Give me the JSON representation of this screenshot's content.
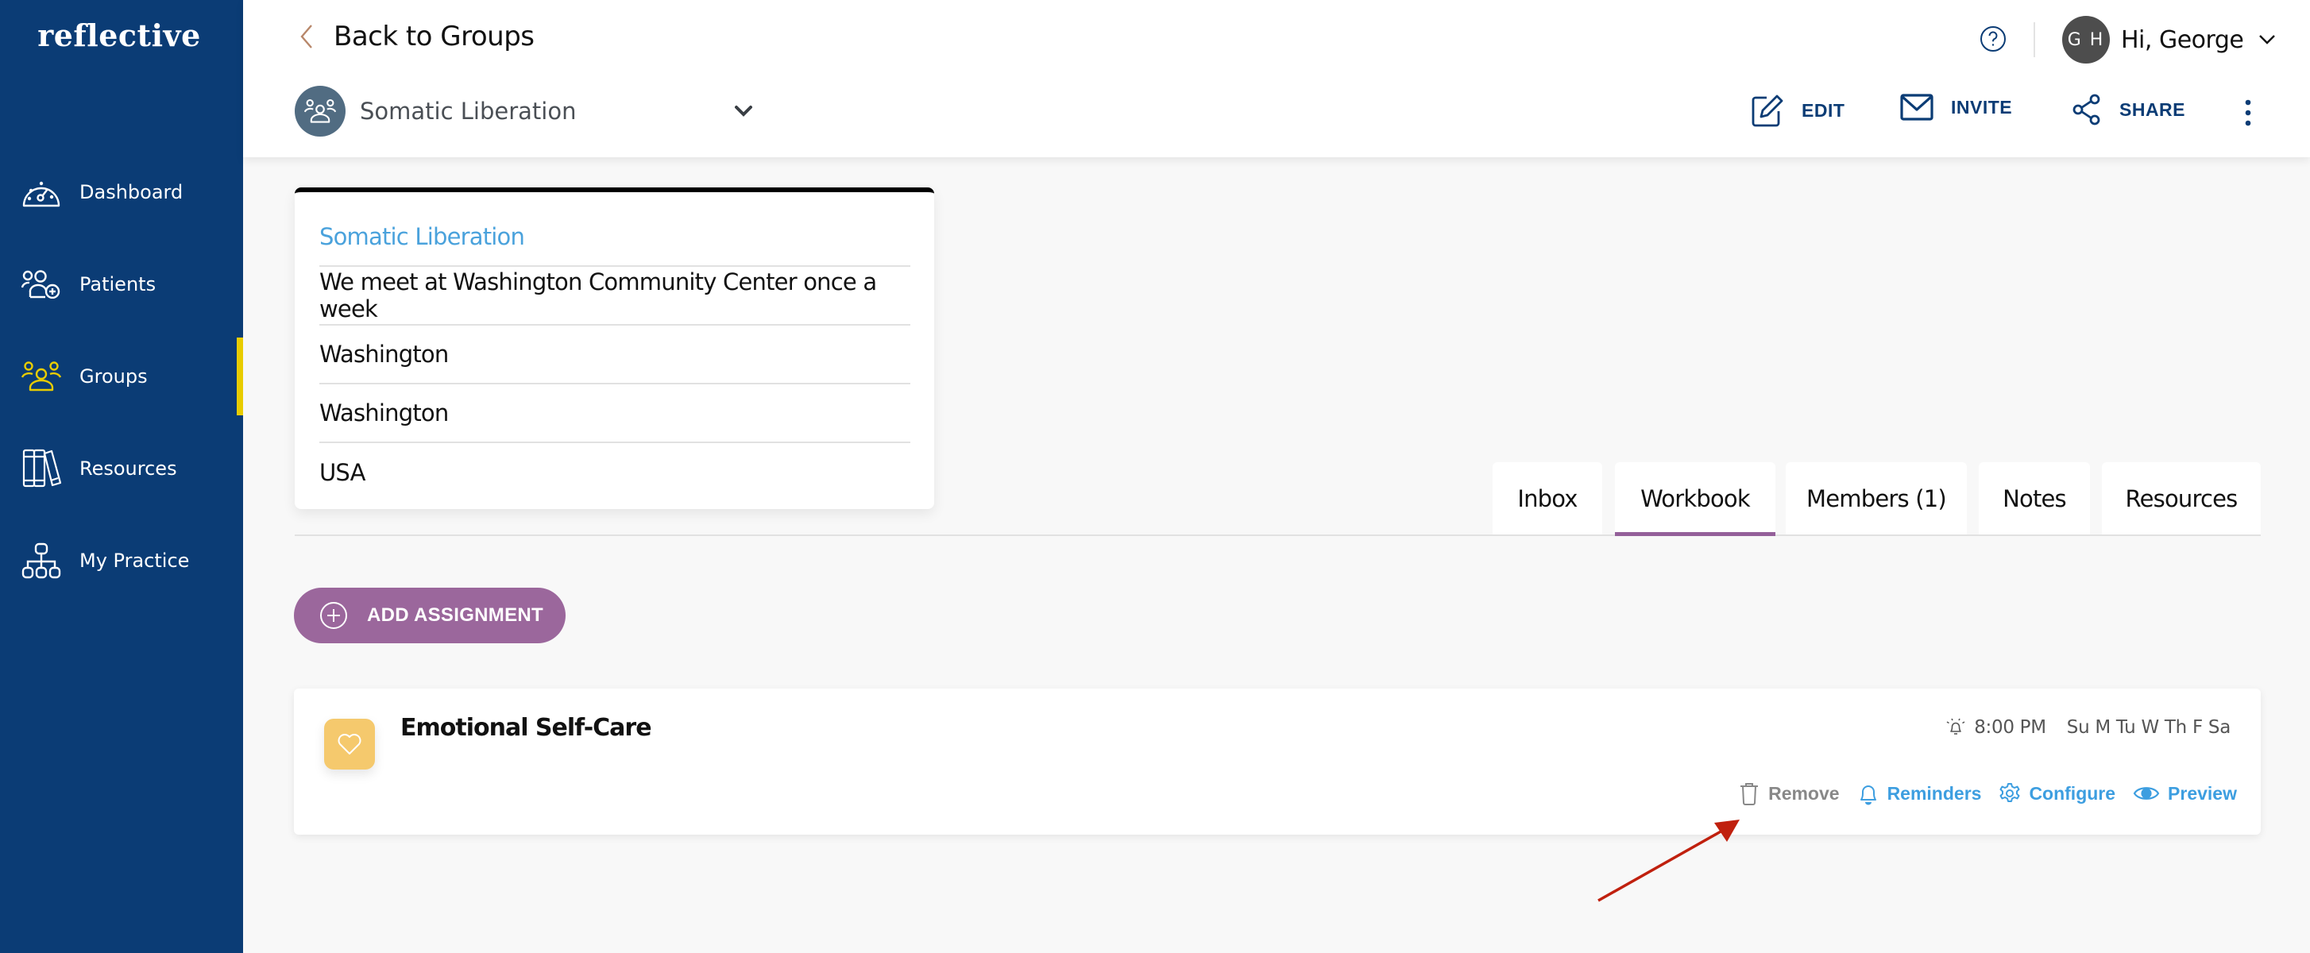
{
  "app": {
    "logo": "reflective",
    "brand_color": "#0b3c75",
    "active_indicator_color": "#e8cc00"
  },
  "sidebar": {
    "items": [
      {
        "label": "Dashboard",
        "icon": "gauge-icon",
        "active": false
      },
      {
        "label": "Patients",
        "icon": "add-users-icon",
        "active": false
      },
      {
        "label": "Groups",
        "icon": "group-icon",
        "active": true
      },
      {
        "label": "Resources",
        "icon": "books-icon",
        "active": false
      },
      {
        "label": "My Practice",
        "icon": "org-chart-icon",
        "active": false
      }
    ]
  },
  "header": {
    "back_label": "Back to Groups",
    "group_selector": {
      "selected": "Somatic Liberation"
    },
    "user": {
      "initials": "G H",
      "greeting": "Hi, George"
    },
    "actions": {
      "edit": "EDIT",
      "invite": "INVITE",
      "share": "SHARE"
    }
  },
  "info_card": {
    "title": "Somatic Liberation",
    "rows": [
      "We meet at Washington Community Center once a week",
      "Washington",
      "Washington",
      "USA"
    ]
  },
  "tabs": {
    "items": [
      "Inbox",
      "Workbook",
      "Members (1)",
      "Notes",
      "Resources"
    ],
    "active": "Workbook",
    "active_color": "#94609a"
  },
  "workbook": {
    "add_button_label": "ADD ASSIGNMENT",
    "add_button_color": "#9b679c",
    "assignments": [
      {
        "title": "Emotional Self-Care",
        "icon": "heart-icon",
        "icon_color": "#f5c96d",
        "reminder_time": "8:00 PM",
        "days": "Su M Tu W Th F Sa",
        "actions": {
          "remove": "Remove",
          "reminders": "Reminders",
          "configure": "Configure",
          "preview": "Preview"
        }
      }
    ]
  },
  "annotation": {
    "color": "#c0200e",
    "target": "Remove"
  }
}
